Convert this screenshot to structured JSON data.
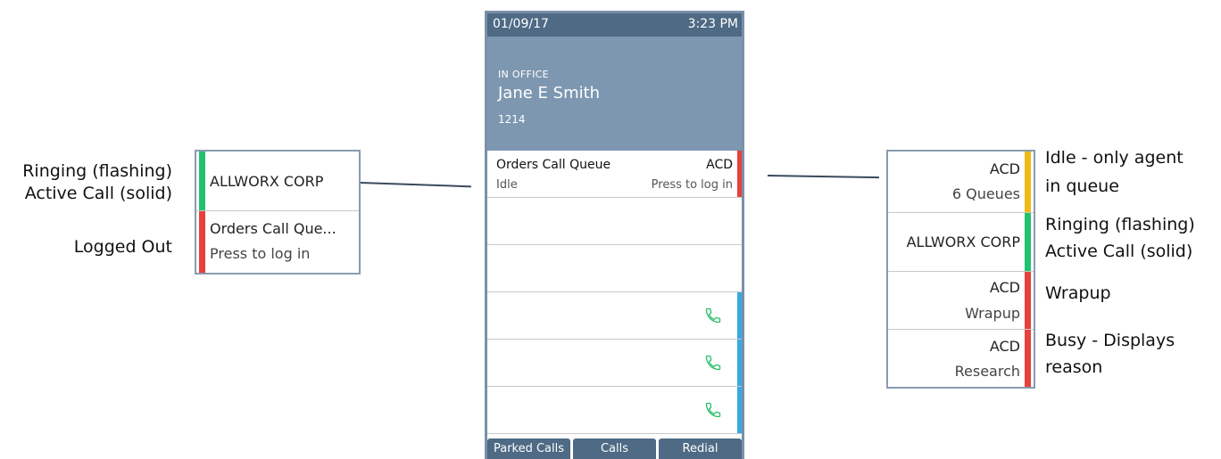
{
  "left_notes": {
    "ringing_flashing": "Ringing (flashing)",
    "active_call_solid": "Active Call (solid)",
    "logged_out": "Logged Out"
  },
  "left_panel": {
    "key1_label": "ALLWORX CORP",
    "key1_color": "#1fc26f",
    "key2_label": "Orders Call Que...",
    "key2_sub": "Press to log in",
    "key2_color": "#e8403a"
  },
  "phone": {
    "date": "01/09/17",
    "time": "3:23 PM",
    "presence": "IN OFFICE",
    "user_name": "Jane E Smith",
    "extension": "1214",
    "queue_key": {
      "title": "Orders Call Queue",
      "tag": "ACD",
      "status": "Idle",
      "action": "Press to log in",
      "color": "#e8403a"
    },
    "park_color": "#3aa9e0",
    "softkeys": [
      "Parked Calls",
      "Calls",
      "Redial"
    ]
  },
  "right_panel": {
    "keys": [
      {
        "title": "ACD",
        "sub": "6 Queues",
        "color": "#f2b817"
      },
      {
        "title": "ALLWORX CORP",
        "sub": "",
        "color": "#1fc26f"
      },
      {
        "title": "ACD",
        "sub": "Wrapup",
        "color": "#e8403a"
      },
      {
        "title": "ACD",
        "sub": "Research",
        "color": "#e8403a"
      }
    ]
  },
  "right_notes": {
    "idle_line1": "Idle - only agent",
    "idle_line2": "in queue",
    "ringing_flashing": "Ringing (flashing)",
    "active_call_solid": "Active Call (solid)",
    "wrapup": "Wrapup",
    "busy_line1": "Busy - Displays",
    "busy_line2": "reason"
  }
}
